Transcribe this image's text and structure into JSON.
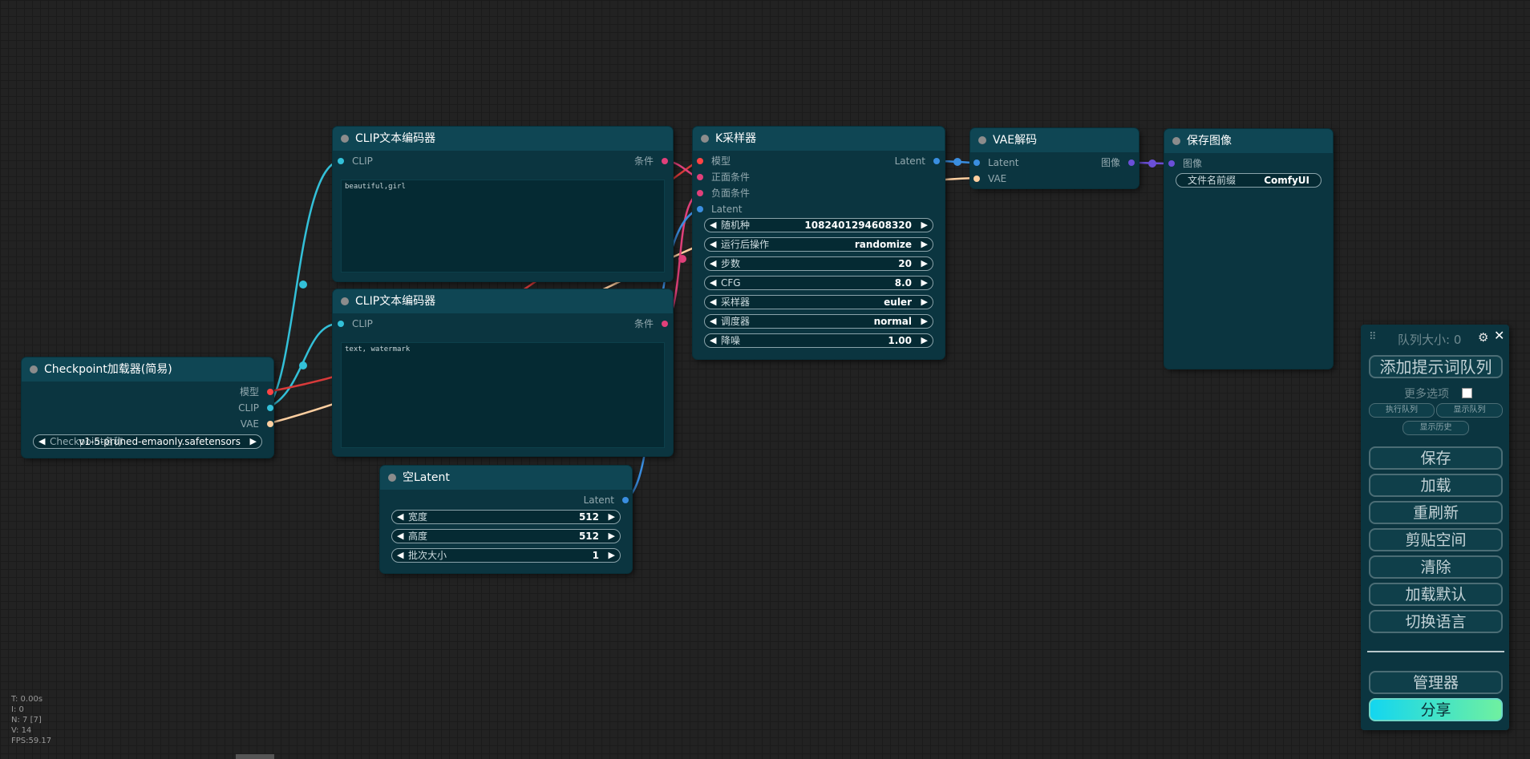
{
  "nodes": {
    "checkpoint": {
      "title": "Checkpoint加载器(简易)",
      "outputs": [
        "模型",
        "CLIP",
        "VAE"
      ],
      "widget_label": "Checkpoint名称",
      "widget_value": "v1-5-pruned-emaonly.safetensors"
    },
    "clip_pos": {
      "title": "CLIP文本编码器",
      "input": "CLIP",
      "output": "条件",
      "text": "beautiful,girl"
    },
    "clip_neg": {
      "title": "CLIP文本编码器",
      "input": "CLIP",
      "output": "条件",
      "text": "text, watermark"
    },
    "empty_latent": {
      "title": "空Latent",
      "output": "Latent",
      "widgets": [
        {
          "label": "宽度",
          "value": "512"
        },
        {
          "label": "高度",
          "value": "512"
        },
        {
          "label": "批次大小",
          "value": "1"
        }
      ]
    },
    "ksampler": {
      "title": "K采样器",
      "inputs": [
        "模型",
        "正面条件",
        "负面条件",
        "Latent"
      ],
      "output": "Latent",
      "widgets": [
        {
          "label": "随机种",
          "value": "1082401294608320"
        },
        {
          "label": "运行后操作",
          "value": "randomize"
        },
        {
          "label": "步数",
          "value": "20"
        },
        {
          "label": "CFG",
          "value": "8.0"
        },
        {
          "label": "采样器",
          "value": "euler"
        },
        {
          "label": "调度器",
          "value": "normal"
        },
        {
          "label": "降噪",
          "value": "1.00"
        }
      ]
    },
    "vae_decode": {
      "title": "VAE解码",
      "inputs": [
        "Latent",
        "VAE"
      ],
      "output": "图像"
    },
    "save_image": {
      "title": "保存图像",
      "input": "图像",
      "widget_label": "文件名前缀",
      "widget_value": "ComfyUI"
    }
  },
  "menu": {
    "queue_size": "队列大小: 0",
    "queue_prompt": "添加提示词队列",
    "extra_options": "更多选项",
    "view_queue": "执行队列",
    "show_queue": "显示队列",
    "view_history": "显示历史",
    "save": "保存",
    "load": "加载",
    "refresh": "重刷新",
    "clipspace": "剪贴空间",
    "clear": "清除",
    "load_default": "加载默认",
    "switch_lang": "切换语言",
    "manager": "管理器",
    "share": "分享"
  },
  "stats": [
    "T: 0.00s",
    "I: 0",
    "N: 7 [7]",
    "V: 14",
    "FPS:59.17"
  ],
  "colors": {
    "model": "#ff4444",
    "clip": "#33c0d8",
    "conditioning": "#e0407a",
    "latent": "#3a8ee0",
    "vae": "#ffcfa0",
    "image": "#6b4fd8",
    "share_gradient": [
      "#13d6f0",
      "#6ff0a0"
    ]
  }
}
